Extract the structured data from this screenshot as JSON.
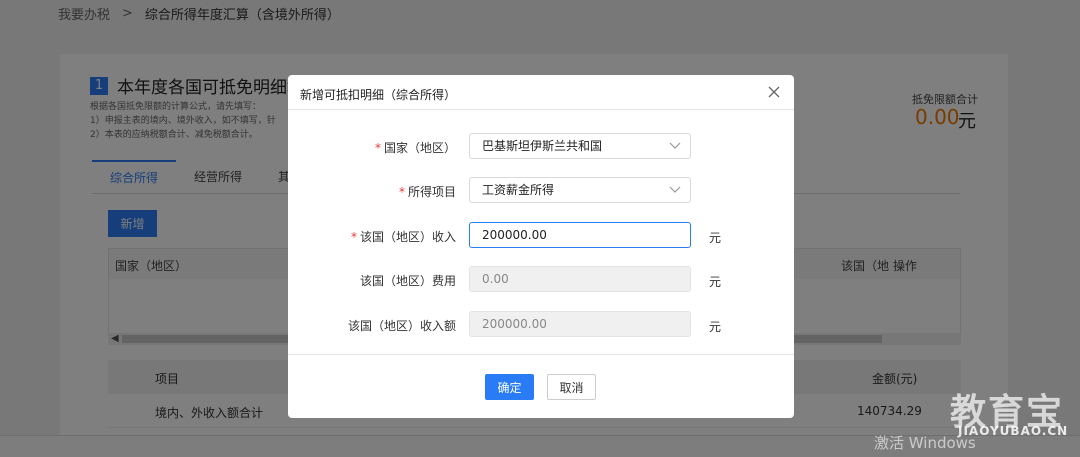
{
  "breadcrumb": {
    "parent": "我要办税",
    "separator": ">",
    "current": "综合所得年度汇算（含境外所得）"
  },
  "section": {
    "number": "1",
    "title": "本年度各国可抵免明细填",
    "hints": [
      "根据各国抵免限额的计算公式，请先填写：",
      "1）申报主表的境内、境外收入，如不填写，针",
      "2）本表的应纳税额合计、减免税额合计。"
    ],
    "sum_label": "抵免限额合计",
    "sum_value": "0.00",
    "sum_unit": "元"
  },
  "tabs": [
    "综合所得",
    "经营所得",
    "其"
  ],
  "add_button": "新增",
  "table1": {
    "col_country": "国家（地区）",
    "col_country_right": "该国（地",
    "col_action": "操作"
  },
  "table2": {
    "col_item": "项目",
    "col_amount": "金额(元)",
    "row_label": "境内、外收入额合计",
    "row_amount": "140734.29"
  },
  "modal": {
    "title": "新增可抵扣明细（综合所得）",
    "fields": {
      "country_label": "国家（地区）",
      "country_value": "巴基斯坦伊斯兰共和国",
      "income_type_label": "所得项目",
      "income_type_value": "工资薪金所得",
      "income_label": "该国（地区）收入",
      "income_value": "200000.00",
      "expense_label": "该国（地区）费用",
      "expense_value": "0.00",
      "net_label": "该国（地区）收入额",
      "net_value": "200000.00",
      "unit": "元",
      "required_mark": "*"
    },
    "confirm_label": "确定",
    "cancel_label": "取消"
  },
  "watermark": {
    "cn": "教育宝",
    "en": "JIAOYUBAO.CN"
  },
  "system": {
    "activate_text": "激活 Windows"
  },
  "colors": {
    "primary": "#2a7cf6",
    "accent_orange": "#f07800",
    "required": "#e53935"
  }
}
